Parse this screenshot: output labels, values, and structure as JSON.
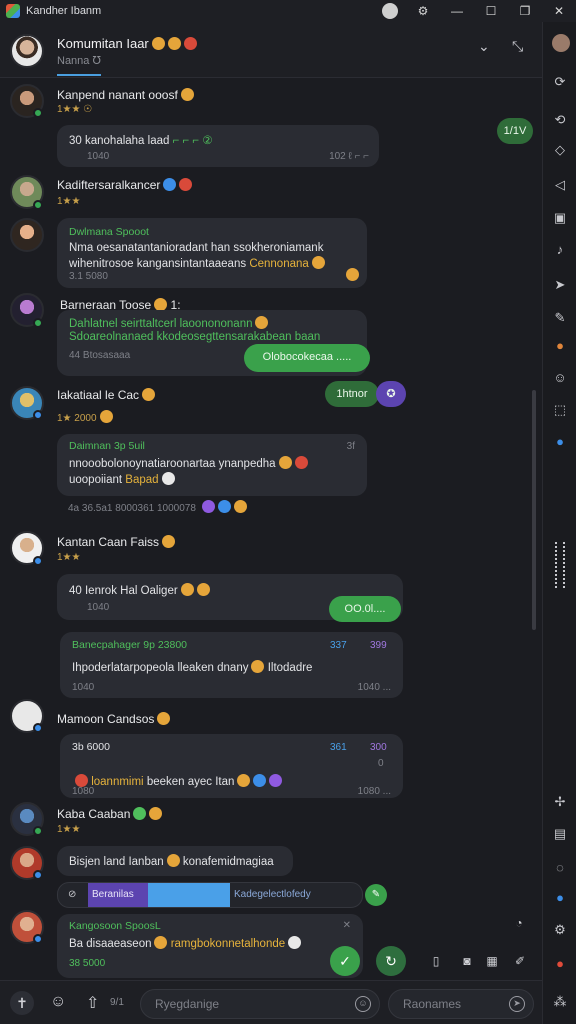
{
  "window": {
    "title": "Kandher Ibanm",
    "controls": [
      "minimize",
      "maximize",
      "restore",
      "close"
    ]
  },
  "header": {
    "title": "Komumitan Iaar",
    "subtitle": "Nanna ℧"
  },
  "messages": [
    {
      "sender": "Kanpend nanant ooosf",
      "meta": "1★★ ☉",
      "bubble_line1": "30   kanohalaha laad",
      "bubble_line1_accent": "⌐ ⌐ ⌐ ②",
      "bubble_time_left": "1040",
      "bubble_time_right": "102 ℓ ⌐ ⌐",
      "outgoing_pill": "1/1V"
    },
    {
      "sender": "Kadiftersaralkancer",
      "meta": "1★★",
      "bubble_head": "Dwlmana  Spooot",
      "bubble_line1": "Nma oesanatantanioradant han ssokheroniamank",
      "bubble_line2": "wihenitrosoe kangansintantaaeans",
      "bubble_line2_accent": "Cennonana",
      "bubble_time": "3.1  5080"
    },
    {
      "sender": "Barneraan Toose",
      "meta_suffix": "1:",
      "bubble_line1": "Dahlatnel seirttaltcerl laoonononann",
      "bubble_line2": "Sdoareolnanaed kkodeosegttensarakabean baan",
      "bubble_time": "44  Btosasaaa",
      "outgoing_pill": "Olobocokecaa  ....."
    },
    {
      "sender": "Iakatiaal le Cac",
      "meta": "1★ 2000",
      "outgoing_pill": "1htnor",
      "bubble_head": "Daimnan   3p 5uil",
      "bubble_head_right": "3f",
      "bubble_line1": "nnooobolonoynatiaroonartaa ynanpedha",
      "bubble_line2": "uoopoiiant",
      "bubble_line2_accent": "Bapad",
      "reactions_text": "4a  36.5a1 8000361 1000078"
    },
    {
      "sender": "Kantan Caan Faiss",
      "meta": "1★★",
      "bubble_line1": "40   Ienrok Hal Oaliger",
      "bubble_time": "1040",
      "outgoing_pill": "OO.0l...."
    },
    {
      "bubble_head": "Banecpahager   9p 23800",
      "bubble_head_right": "337",
      "bubble_head_tag": "399",
      "bubble_line1": "Ihpoderlatarpopeola lleaken dnany",
      "bubble_line1_tail": "Iltodadre",
      "bubble_time_left": "1040",
      "bubble_time_right": "1040 ..."
    },
    {
      "sender": "Mamoon Candsos",
      "bubble_head": "3b 6000",
      "bubble_head_right": "361",
      "bubble_head_tag": "300",
      "bubble_head_right2": "0",
      "bubble_line1_accent": "loannmimi",
      "bubble_line1": "beeken ayec Itan",
      "bubble_time_left": "1080",
      "bubble_time_right": "1080 ..."
    },
    {
      "sender": "Kaba Caaban",
      "meta": "1★★"
    },
    {
      "bubble_line1": "Bisjen land Ianban",
      "bubble_line1_tail": "konafemidmagiaa",
      "attachment_left": "Beranilas",
      "attachment_right": "Kadegelectlofedy"
    },
    {
      "bubble_head": "Kangosoon  SpoosL",
      "bubble_line1": "Ba disaaeaseon",
      "bubble_line1_accent": "ramgbokonnetalhonde",
      "bubble_time": "38  5000"
    }
  ],
  "compose": {
    "counter": "9/1",
    "placeholder": "Ryegdanige",
    "placeholder2": "Raonames"
  },
  "colors": {
    "background": "#1b1c21",
    "bubble": "#2a2c33",
    "accent_green": "#3aa14b",
    "accent_blue": "#3c8ee8",
    "accent_purple": "#5c44b0",
    "accent_orange": "#e6b33c"
  },
  "icons": [
    "search-icon",
    "tiktok-icon",
    "chevron-down-icon",
    "close-icon",
    "refresh-icon",
    "chat-icon",
    "send-icon",
    "bell-icon",
    "star-icon",
    "check-icon",
    "menu-icon",
    "attach-icon",
    "emoji-icon",
    "share-icon"
  ]
}
